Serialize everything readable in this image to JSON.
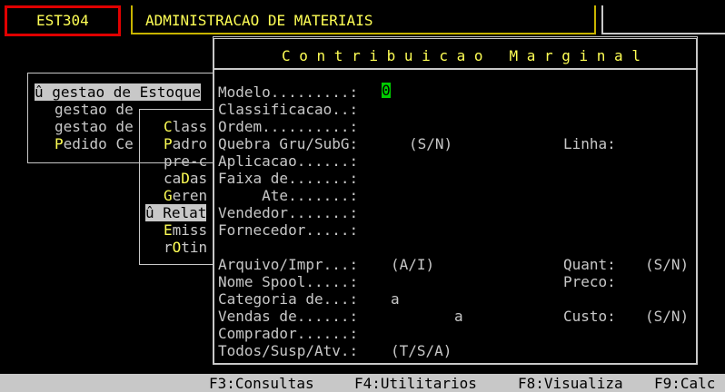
{
  "header": {
    "program_code": "EST304",
    "system_title": "ADMINISTRACAO DE MATERIAIS"
  },
  "menu1": {
    "items": [
      {
        "marker": "û",
        "label": "gestao de Estoque"
      },
      {
        "marker": "",
        "label": "gestao de"
      },
      {
        "marker": "",
        "label": "gestao de"
      },
      {
        "marker": "",
        "label": "Pedido Ce"
      }
    ]
  },
  "menu2": {
    "items": [
      "Class",
      "Padro",
      "pre-c",
      "caDas",
      "Geren",
      "û Relat",
      "Emiss",
      "rOtin"
    ]
  },
  "dialog": {
    "title": "C o n t r i b u i c a o   M a r g i n a l",
    "cursor_char": "0",
    "labels": {
      "modelo": "Modelo.........:",
      "classificacao": "Classificacao..:",
      "ordem": "Ordem..........:",
      "quebra": "Quebra Gru/SubG:",
      "aplicacao": "Aplicacao......:",
      "faixa": "Faixa de.......:",
      "ate": "     Ate.......:",
      "vendedor": "Vendedor.......:",
      "fornecedor": "Fornecedor.....:",
      "arquivo": "Arquivo/Impr...:",
      "nome_spool": "Nome Spool.....:",
      "categoria": "Categoria de...:",
      "vendas": "Vendas de......:",
      "comprador": "Comprador......:",
      "todos": "Todos/Susp/Atv.:"
    },
    "values": {
      "quebra_hint": "(S/N)",
      "linha_label": "Linha:",
      "arquivo_hint": "(A/I)",
      "quant_label": "Quant:",
      "quant_hint": "(S/N)",
      "preco_label": "Preco:",
      "categoria_a": "a",
      "vendas_a": "a",
      "custo_label": "Custo:",
      "custo_hint": "(S/N)",
      "todos_hint": "(T/S/A)"
    }
  },
  "function_bar": {
    "f3": "F3:Consultas",
    "f4": "F4:Utilitarios",
    "f8": "F8:Visualiza",
    "f9": "F9:Calc"
  }
}
